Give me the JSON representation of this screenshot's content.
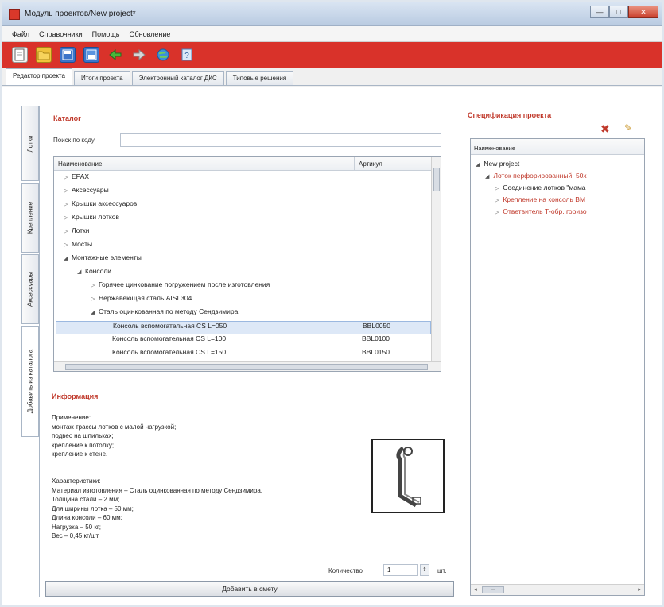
{
  "window": {
    "title": "Модуль проектов/New project*",
    "buttons": {
      "minimize": "—",
      "maximize": "□",
      "close": "✕"
    }
  },
  "menu": [
    "Файл",
    "Справочники",
    "Помощь",
    "Обновление"
  ],
  "toolbar": {
    "icons": [
      "new-document",
      "open-folder",
      "save",
      "save-as",
      "export-green",
      "import",
      "globe",
      "help"
    ],
    "accent_color": "#d9322a"
  },
  "tabs": [
    "Редактор проекта",
    "Итоги проекта",
    "Электронный каталог ДКС",
    "Типовые решения"
  ],
  "vertical_tabs": [
    "Лотки",
    "Крепление",
    "Аксессуары",
    "Добавить из каталога"
  ],
  "catalog": {
    "title": "Каталог",
    "search_label": "Поиск по коду",
    "search_value": "",
    "columns": [
      "Наименование",
      "Артикул"
    ],
    "rows": [
      {
        "indent": 0,
        "toggle": "▷",
        "label": "EPAX",
        "article": ""
      },
      {
        "indent": 0,
        "toggle": "▷",
        "label": "Аксессуары",
        "article": ""
      },
      {
        "indent": 0,
        "toggle": "▷",
        "label": "Крышки аксессуаров",
        "article": ""
      },
      {
        "indent": 0,
        "toggle": "▷",
        "label": "Крышки лотков",
        "article": ""
      },
      {
        "indent": 0,
        "toggle": "▷",
        "label": "Лотки",
        "article": ""
      },
      {
        "indent": 0,
        "toggle": "▷",
        "label": "Мосты",
        "article": ""
      },
      {
        "indent": 0,
        "toggle": "◢",
        "label": "Монтажные элементы",
        "article": ""
      },
      {
        "indent": 1,
        "toggle": "◢",
        "label": "Консоли",
        "article": ""
      },
      {
        "indent": 2,
        "toggle": "▷",
        "label": "Горячее цинкование погружением после изготовления",
        "article": ""
      },
      {
        "indent": 2,
        "toggle": "▷",
        "label": "Нержавеющая сталь AISI 304",
        "article": ""
      },
      {
        "indent": 2,
        "toggle": "◢",
        "label": "Сталь оцинкованная по методу Сендзимира",
        "article": ""
      },
      {
        "indent": 3,
        "toggle": "",
        "label": "Консоль вспомогательная CS L=050",
        "article": "BBL0050",
        "selected": true
      },
      {
        "indent": 3,
        "toggle": "",
        "label": "Консоль вспомогательная CS L=100",
        "article": "BBL0100"
      },
      {
        "indent": 3,
        "toggle": "",
        "label": "Консоль вспомогательная CS L=150",
        "article": "BBL0150"
      }
    ]
  },
  "info": {
    "title": "Информация",
    "purpose_title": "Применение:",
    "purpose_lines": [
      "монтаж трассы лотков с малой нагрузкой;",
      "подвес на шпильках;",
      "крепление к потолку;",
      "крепление к стене."
    ],
    "specs_title": "Характеристики:",
    "specs_lines": [
      "Материал изготовления – Сталь оцинкованная по методу Сендзимира.",
      "Толщина стали – 2 мм;",
      "Для ширины лотка – 50 мм;",
      "Длина консоли – 60 мм;",
      "Нагрузка – 50 кг;",
      "Вес – 0,45 кг/шт"
    ]
  },
  "quantity": {
    "label": "Количество",
    "value": "1",
    "unit": "шт."
  },
  "add_button": "Добавить в смету",
  "spec": {
    "title": "Спецификация проекта",
    "column": "Наименование",
    "rows": [
      {
        "indent": 0,
        "toggle": "◢",
        "label": "New project",
        "color": "#222"
      },
      {
        "indent": 1,
        "toggle": "◢",
        "label": "Лоток перфорированный, 50х",
        "color": "#c0392b"
      },
      {
        "indent": 2,
        "toggle": "▷",
        "label": "Соединение лотков \"мама",
        "color": "#222"
      },
      {
        "indent": 2,
        "toggle": "▷",
        "label": "Крепление на консоль BM",
        "color": "#c0392b"
      },
      {
        "indent": 2,
        "toggle": "▷",
        "label": "Ответвитель Т-обр. горизо",
        "color": "#c0392b"
      }
    ],
    "scroll_label": "···"
  }
}
